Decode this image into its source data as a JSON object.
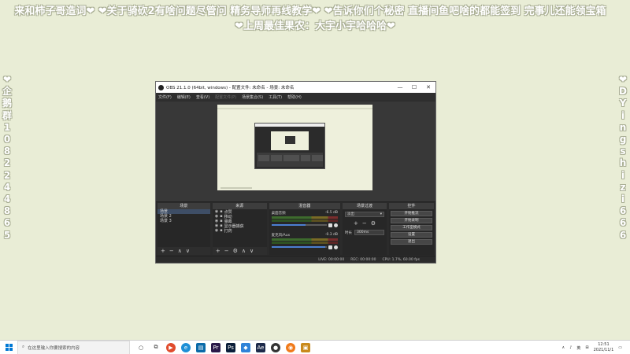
{
  "overlay": {
    "banner_line1": "来和柿子哥造词❤ ❤关于骑砍2有啥问题尽管问 精务导师再线教学❤ ❤告诉你们个秘密 直播间鱼吧啥的都能签到 完事儿还能领宝箱",
    "banner_line2": "❤上周最佳果农：大宇小宇哈哈哈❤",
    "left_column": [
      "❤",
      "企",
      "鹅",
      "群",
      "1",
      "0",
      "8",
      "2",
      "2",
      "4",
      "4",
      "8",
      "6",
      "5"
    ],
    "right_column": [
      "❤",
      "D",
      "Y",
      "i",
      "n",
      "g",
      "s",
      "h",
      "i",
      "z",
      "i",
      "6",
      "6",
      "6"
    ]
  },
  "obs": {
    "title": "OBS 21.1.0 (64bit, windows) - 配置文件: 未命名 - 场景: 未命名",
    "window_controls": {
      "minimize": "—",
      "maximize": "☐",
      "close": "✕"
    },
    "menu": [
      "文件(F)",
      "编辑(E)",
      "查看(V)",
      "配置文件(P)",
      "场景集合(S)",
      "工具(T)",
      "帮助(H)"
    ],
    "docks": {
      "scenes": {
        "title": "场景",
        "items": [
          "场景",
          "场景 2",
          "场景 3"
        ]
      },
      "sources": {
        "title": "来源",
        "items": [
          "点赞",
          "移动",
          "弹幕",
          "显示器捕获",
          "打药"
        ]
      },
      "mixer": {
        "title": "混音器",
        "channels": [
          {
            "name": "桌面音频",
            "db": "-6.5 dB",
            "volume": 0.62
          },
          {
            "name": "麦克风/Aux",
            "db": "-0.3 dB",
            "volume": 0.97
          }
        ]
      },
      "transitions": {
        "title": "场景过渡",
        "selected": "淡出",
        "duration_label": "时长",
        "duration_value": "300ms"
      },
      "controls": {
        "title": "控件",
        "buttons": [
          "开始推流",
          "开始录制",
          "工作室模式",
          "设置",
          "退出"
        ]
      }
    },
    "status": {
      "live": "LIVE: 00:00:00",
      "rec": "REC: 00:00:00",
      "cpu": "CPU: 1.7%, 60.00 fps"
    }
  },
  "taskbar": {
    "search_placeholder": "在这里输入你要搜索的内容",
    "tray_lang": "英",
    "time": "12:51",
    "date": "2021/11/1"
  }
}
